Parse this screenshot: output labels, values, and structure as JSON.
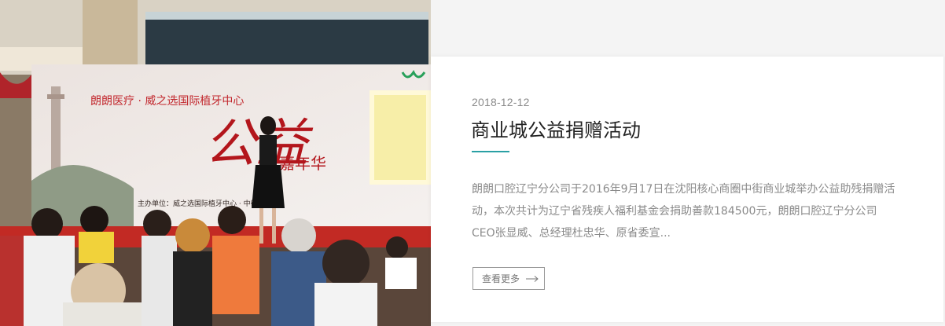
{
  "article": {
    "date": "2018-12-12",
    "title": "商业城公益捐赠活动",
    "summary": "朗朗口腔辽宁分公司于2016年9月17日在沈阳核心商圈中街商业城举办公益助残捐赠活动，本次共计为辽宁省残疾人福利基金会捐助善款184500元，朗朗口腔辽宁分公司CEO张显威、总经理杜忠华、原省委宣...",
    "more_label": "查看更多"
  },
  "photo": {
    "banner_line1": "朗朗医疗 · 威之选国际植牙中心",
    "banner_big": "公益",
    "banner_sub": "嘉年华",
    "banner_bottom": "主办单位：威之选国际植牙中心 · 中街商业城"
  },
  "colors": {
    "accent": "#2aa0a4",
    "title": "#222222",
    "text": "#8a8a8a",
    "date": "#8c8c8c"
  }
}
